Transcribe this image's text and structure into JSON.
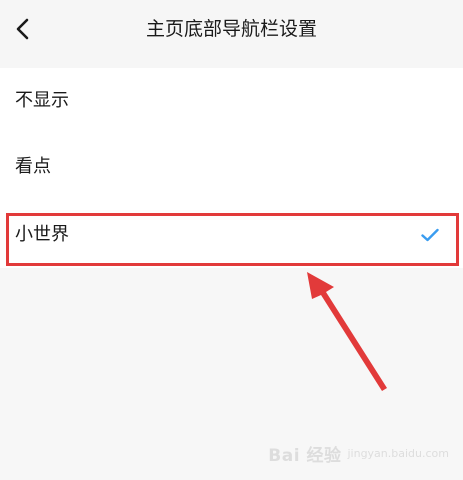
{
  "header": {
    "title": "主页底部导航栏设置",
    "back_icon": "chevron-left-icon"
  },
  "options": [
    {
      "label": "不显示",
      "selected": false
    },
    {
      "label": "看点",
      "selected": false
    },
    {
      "label": "小世界",
      "selected": true
    }
  ],
  "check_icon": "check-icon",
  "colors": {
    "accent": "#3a9cf0",
    "annotation": "#e23a3a"
  },
  "watermark": {
    "logo": "Bai 经验",
    "sub": "jingyan.baidu.com"
  }
}
